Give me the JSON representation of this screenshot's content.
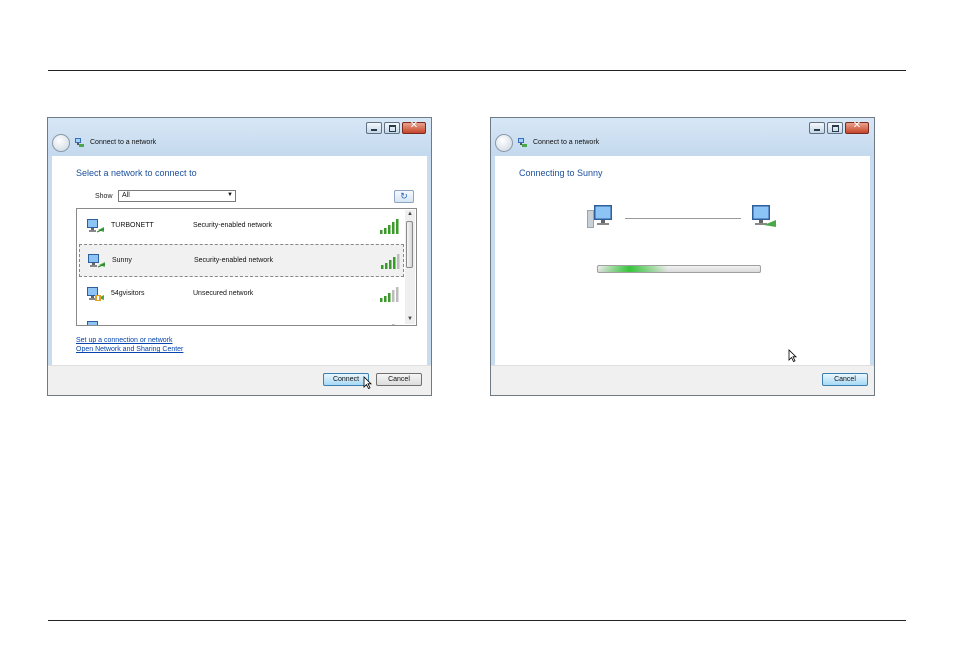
{
  "left_dialog": {
    "window_title": "Connect to a network",
    "heading": "Select a network to connect to",
    "show_label": "Show",
    "show_value": "All",
    "networks": [
      {
        "name": "TURBONETT",
        "security": "Security-enabled network",
        "signal_bars": 5,
        "selected": false
      },
      {
        "name": "Sunny",
        "security": "Security-enabled network",
        "signal_bars": 4,
        "selected": true
      },
      {
        "name": "54gvisitors",
        "security": "Unsecured network",
        "signal_bars": 4,
        "selected": false
      }
    ],
    "link_setup": "Set up a connection or network",
    "link_sharing": "Open Network and Sharing Center",
    "connect_label": "Connect",
    "cancel_label": "Cancel"
  },
  "right_dialog": {
    "window_title": "Connect to a network",
    "heading": "Connecting to Sunny",
    "cancel_label": "Cancel"
  },
  "colors": {
    "heading_blue": "#1c4f9c",
    "link_blue": "#0645ad",
    "signal_green": "#3a9a2a",
    "progress_green": "#37c43b"
  },
  "icons": [
    "back-arrow-icon",
    "network-icon",
    "minimize-icon",
    "maximize-icon",
    "close-icon",
    "refresh-icon",
    "wireless-network-icon",
    "signal-strength-icon",
    "computer-icon",
    "mouse-cursor-icon"
  ]
}
